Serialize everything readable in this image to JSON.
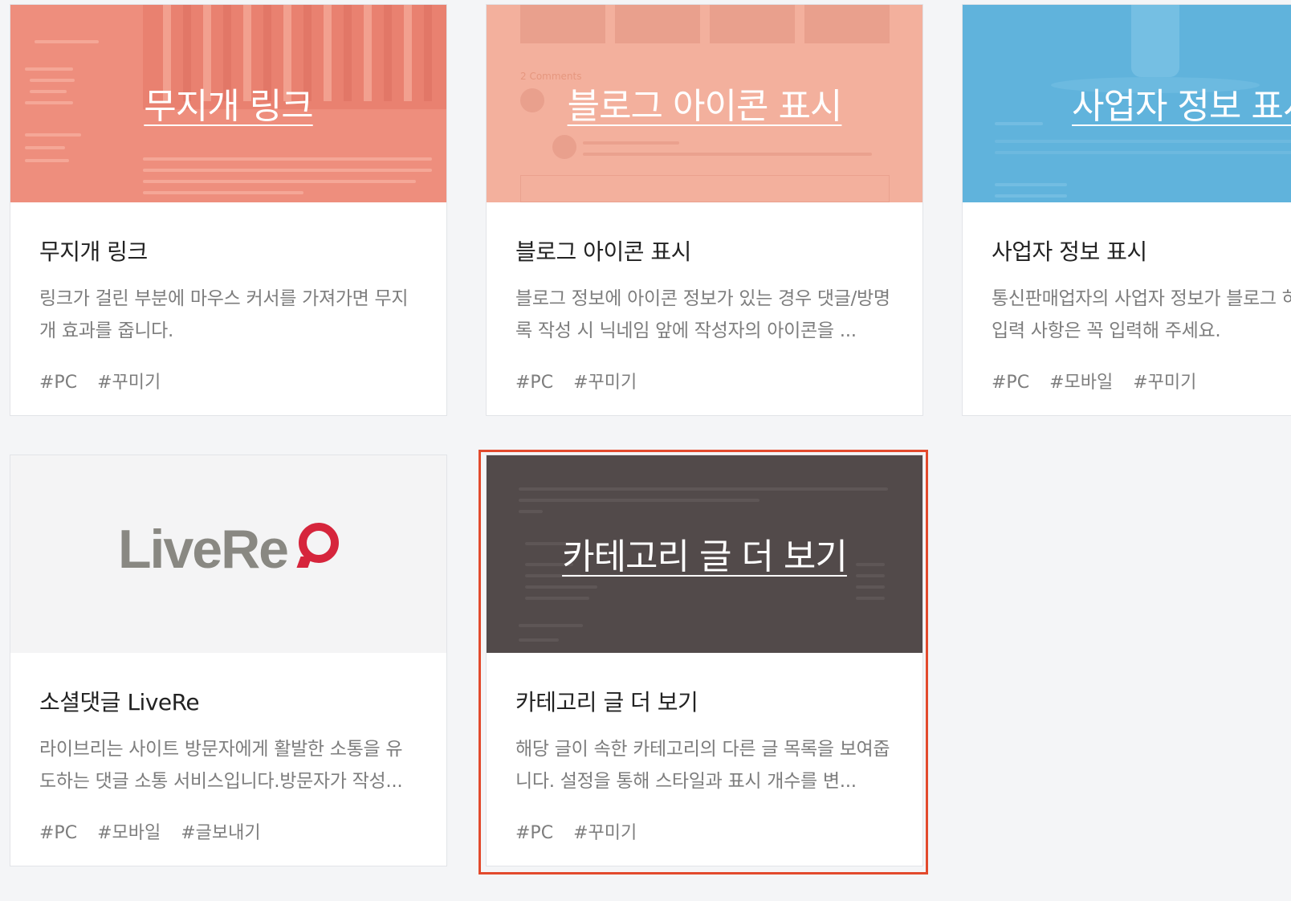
{
  "cards": [
    {
      "overlay_title": "무지개 링크",
      "title": "무지개 링크",
      "desc": "링크가 걸린 부분에 마우스 커서를 가져가면 무지개 효과를 줍니다.",
      "tags": [
        "#PC",
        "#꾸미기"
      ],
      "thumb_color": "#ee8e7d"
    },
    {
      "overlay_title": "블로그 아이콘 표시",
      "overlay_comments": "2 Comments",
      "title": "블로그 아이콘 표시",
      "desc": "블로그 정보에 아이콘 정보가 있는 경우 댓글/방명록 작성 시 닉네임 앞에 작성자의 아이콘을 ...",
      "tags": [
        "#PC",
        "#꾸미기"
      ],
      "thumb_color": "#f3b09d"
    },
    {
      "overlay_title": "사업자 정보 표시",
      "title": "사업자 정보 표시",
      "desc": "통신판매업자의 사업자 정보가 블로그 하단에 표시됩니다. 필수 입력 사항은 꼭 입력해 주세요.",
      "tags": [
        "#PC",
        "#모바일",
        "#꾸미기"
      ],
      "thumb_color": "#60b3dc"
    },
    {
      "logo_text": "LiveRe",
      "title": "소셜댓글 LiveRe",
      "desc": "라이브리는 사이트 방문자에게 활발한 소통을 유도하는 댓글 소통 서비스입니다.방문자가 작성...",
      "tags": [
        "#PC",
        "#모바일",
        "#글보내기"
      ],
      "thumb_color": "#f4f4f5"
    },
    {
      "overlay_title": "카테고리 글 더 보기",
      "title": "카테고리 글 더 보기",
      "desc": "해당 글이 속한 카테고리의 다른 글 목록을 보여줍니다. 설정을 통해 스타일과 표시 개수를 변...",
      "tags": [
        "#PC",
        "#꾸미기"
      ],
      "thumb_color": "#524a4a"
    }
  ],
  "colors": {
    "page_bg": "#f4f5f7",
    "highlight_border": "#e24a2d",
    "livere_red": "#d6253c",
    "livere_gray": "#898882"
  }
}
